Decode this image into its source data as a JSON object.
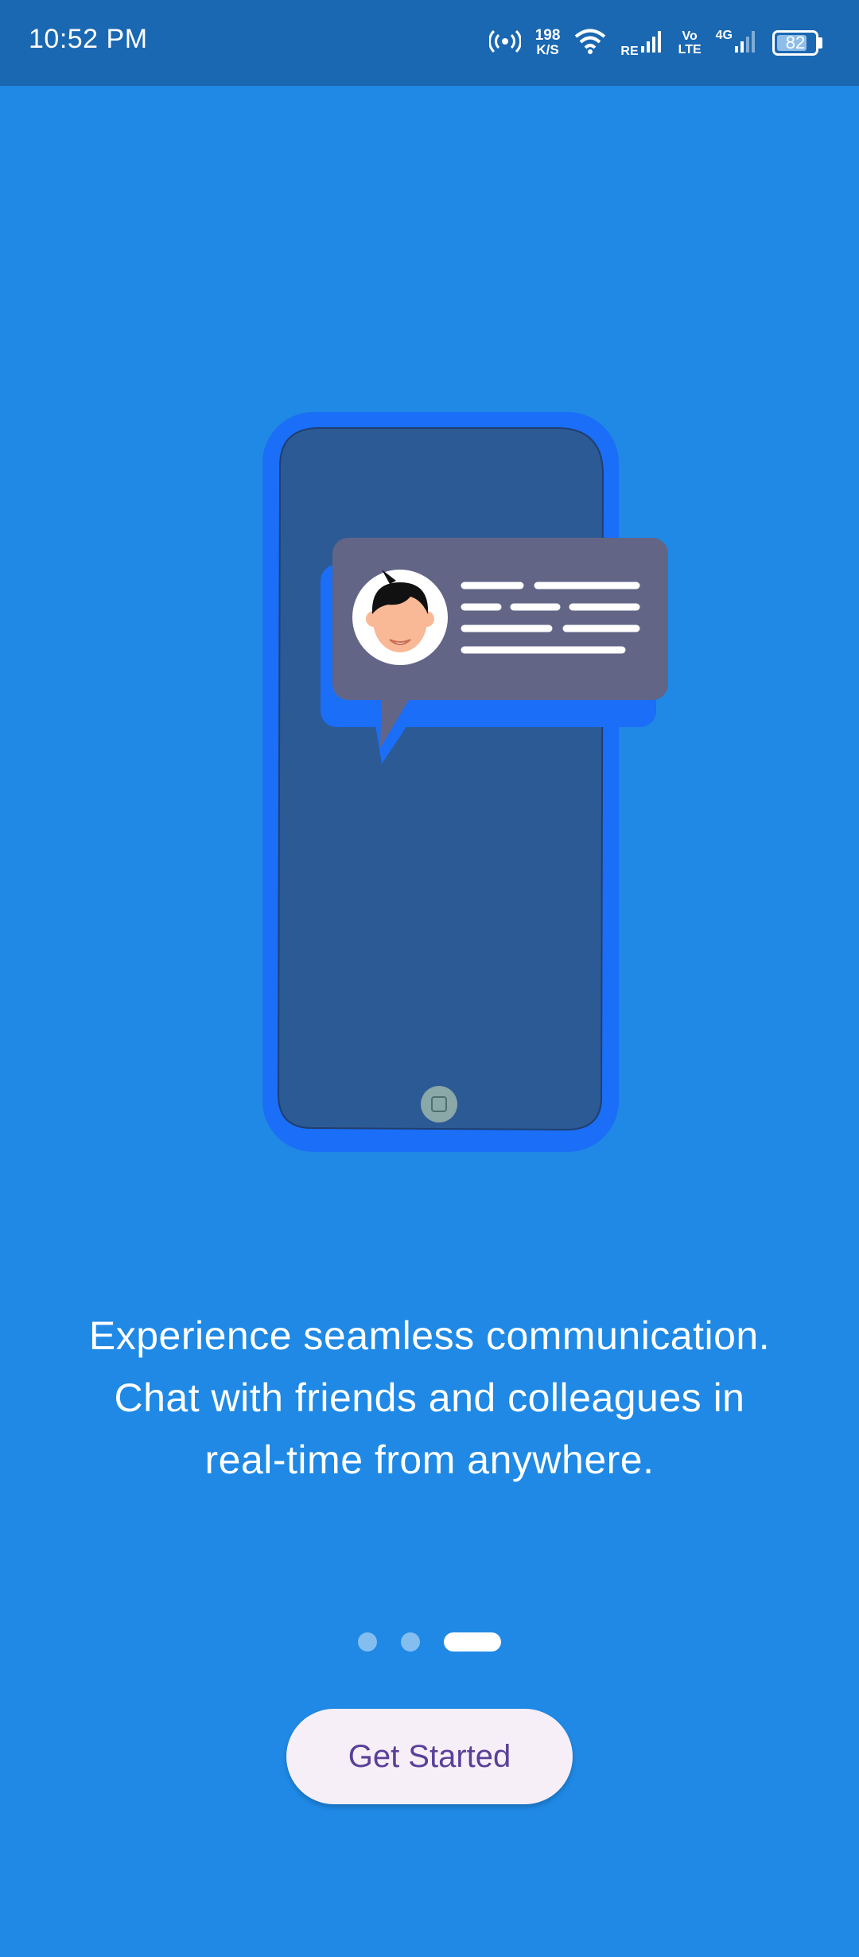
{
  "status_bar": {
    "time": "10:52 PM",
    "speed_value": "198",
    "speed_unit": "K/S",
    "sim1_label": "RE",
    "volte_top": "Vo",
    "volte_bottom": "LTE",
    "network_label": "4G",
    "battery_level": "82",
    "battery_fraction": 0.82,
    "icons": [
      "hotspot-icon",
      "wifi-icon",
      "signal-icon",
      "signal-icon",
      "battery-icon"
    ]
  },
  "onboarding": {
    "message_lines": [
      "Experience seamless communication.",
      "Chat with friends and colleagues in",
      "real-time from anywhere."
    ],
    "page_count": 3,
    "active_page": 3,
    "button_label": "Get Started"
  },
  "colors": {
    "background": "#1f89e5",
    "status_bar": "#1a68b2",
    "phone_frame": "#1a6ef7",
    "phone_screen": "#2c5a95",
    "chat_bubble": "#626586",
    "button_bg": "#f6eff7",
    "button_text": "#5a3f99"
  }
}
